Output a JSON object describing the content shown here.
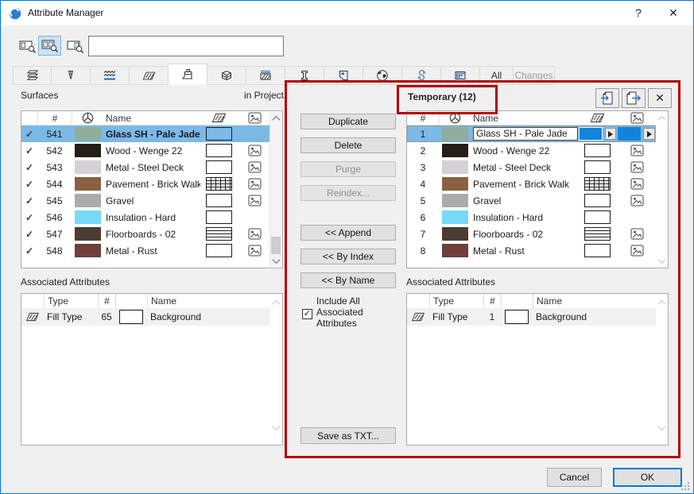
{
  "window": {
    "title": "Attribute Manager",
    "help_label": "?",
    "close_label": "✕"
  },
  "toolbar": {
    "search_value": ""
  },
  "tabs": {
    "icons": [
      "layers",
      "pens",
      "line-types",
      "fill-types",
      "surfaces",
      "composites",
      "building-materials",
      "profiles",
      "zone-categories",
      "cities",
      "mep-systems",
      "operation-profiles"
    ],
    "active": "surfaces",
    "all_label": "All",
    "changes_label": "Changes"
  },
  "left": {
    "title": "Surfaces",
    "scope": "in Project",
    "headers": {
      "num": "#",
      "name": "Name"
    },
    "rows": [
      {
        "check": "✓",
        "num": "541",
        "color": "#8FAE9C",
        "name": "Glass SH - Pale Jade",
        "fill": "fill-sel",
        "img": "img-off"
      },
      {
        "check": "✓",
        "num": "542",
        "color": "#261D17",
        "name": "Wood - Wenge 22",
        "fill": "fill-plain",
        "img": "img-on"
      },
      {
        "check": "✓",
        "num": "543",
        "color": "#D6D1D5",
        "name": "Metal - Steel Deck",
        "fill": "fill-plain",
        "img": "img-on"
      },
      {
        "check": "✓",
        "num": "544",
        "color": "#8A6140",
        "name": "Pavement - Brick Walk",
        "fill": "fill-brick",
        "img": "img-on"
      },
      {
        "check": "✓",
        "num": "545",
        "color": "#ACACAC",
        "name": "Gravel",
        "fill": "fill-plain",
        "img": "img-on"
      },
      {
        "check": "✓",
        "num": "546",
        "color": "#77D9F7",
        "name": "Insulation - Hard",
        "fill": "fill-plain",
        "img": "img-off"
      },
      {
        "check": "✓",
        "num": "547",
        "color": "#4B3D32",
        "name": "Floorboards - 02",
        "fill": "fill-lines",
        "img": "img-on"
      },
      {
        "check": "✓",
        "num": "548",
        "color": "#6F3E39",
        "name": "Metal - Rust",
        "fill": "fill-plain",
        "img": "img-on"
      }
    ],
    "assoc": {
      "title": "Associated Attributes",
      "headers": {
        "type": "Type",
        "num": "#",
        "name": "Name"
      },
      "rows": [
        {
          "type": "Fill Type",
          "num": "65",
          "name": "Background"
        }
      ]
    }
  },
  "middle": {
    "duplicate": "Duplicate",
    "delete": "Delete",
    "purge": "Purge",
    "reindex": "Reindex...",
    "append": "<< Append",
    "by_index": "<< By Index",
    "by_name": "<< By Name",
    "include_label": "Include All Associated Attributes",
    "checkbox_glyph": "✓",
    "save_txt": "Save as TXT..."
  },
  "right": {
    "title": "Temporary (12)",
    "headers": {
      "num": "#",
      "name": "Name"
    },
    "rows": [
      {
        "num": "1",
        "color": "#8FAE9C",
        "name": "Glass SH - Pale Jade",
        "fill": "fill-blue",
        "img": "img-off"
      },
      {
        "num": "2",
        "color": "#261D17",
        "name": "Wood - Wenge 22",
        "fill": "fill-plain",
        "img": "img-on"
      },
      {
        "num": "3",
        "color": "#D6D1D5",
        "name": "Metal - Steel Deck",
        "fill": "fill-plain",
        "img": "img-on"
      },
      {
        "num": "4",
        "color": "#8A6140",
        "name": "Pavement - Brick Walk",
        "fill": "fill-brick",
        "img": "img-on"
      },
      {
        "num": "5",
        "color": "#ACACAC",
        "name": "Gravel",
        "fill": "fill-plain",
        "img": "img-on"
      },
      {
        "num": "6",
        "color": "#77D9F7",
        "name": "Insulation - Hard",
        "fill": "fill-plain",
        "img": "img-off"
      },
      {
        "num": "7",
        "color": "#4B3D32",
        "name": "Floorboards - 02",
        "fill": "fill-lines",
        "img": "img-on"
      },
      {
        "num": "8",
        "color": "#6F3E39",
        "name": "Metal - Rust",
        "fill": "fill-plain",
        "img": "img-on"
      }
    ],
    "assoc": {
      "title": "Associated Attributes",
      "headers": {
        "type": "Type",
        "num": "#",
        "name": "Name"
      },
      "rows": [
        {
          "type": "Fill Type",
          "num": "1",
          "name": "Background"
        }
      ]
    }
  },
  "footer": {
    "cancel": "Cancel",
    "ok": "OK"
  },
  "colors": {
    "selection": "#7CB9E7",
    "swatch_blue": "#1184DC",
    "annotation_red": "#B00000",
    "window_accent": "#0078D7"
  }
}
